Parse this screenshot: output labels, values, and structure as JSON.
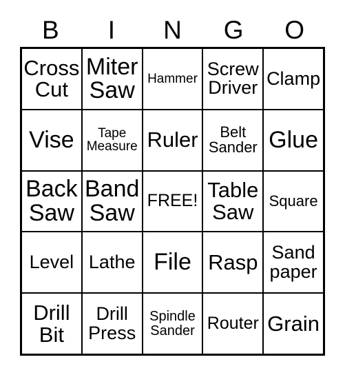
{
  "card": {
    "title": "BINGO",
    "free_space_label": "FREE!",
    "colors": {
      "background": "#ffffff",
      "text": "#000000",
      "border": "#000000"
    },
    "header": {
      "letters": [
        "B",
        "I",
        "N",
        "G",
        "O"
      ]
    },
    "grid": {
      "columns": 5,
      "rows": 5,
      "cells": [
        [
          {
            "label": "Cross\nCut",
            "size": "fs-lg",
            "free": false
          },
          {
            "label": "Miter\nSaw",
            "size": "fs-xl",
            "free": false
          },
          {
            "label": "Hammer",
            "size": "fs-tiny",
            "free": false
          },
          {
            "label": "Screw\nDriver",
            "size": "fs-md",
            "free": false
          },
          {
            "label": "Clamp",
            "size": "fs-md",
            "free": false
          }
        ],
        [
          {
            "label": "Vise",
            "size": "fs-xl",
            "free": false
          },
          {
            "label": "Tape\nMeasure",
            "size": "fs-tiny",
            "free": false
          },
          {
            "label": "Ruler",
            "size": "fs-lg",
            "free": false
          },
          {
            "label": "Belt\nSander",
            "size": "fs-xs",
            "free": false
          },
          {
            "label": "Glue",
            "size": "fs-xl",
            "free": false
          }
        ],
        [
          {
            "label": "Back\nSaw",
            "size": "fs-xl",
            "free": false
          },
          {
            "label": "Band\nSaw",
            "size": "fs-xl",
            "free": false
          },
          {
            "label": "FREE!",
            "size": "fs-sm",
            "free": true
          },
          {
            "label": "Table\nSaw",
            "size": "fs-lg",
            "free": false
          },
          {
            "label": "Square",
            "size": "fs-xs",
            "free": false
          }
        ],
        [
          {
            "label": "Level",
            "size": "fs-md",
            "free": false
          },
          {
            "label": "Lathe",
            "size": "fs-md",
            "free": false
          },
          {
            "label": "File",
            "size": "fs-xl",
            "free": false
          },
          {
            "label": "Rasp",
            "size": "fs-lg",
            "free": false
          },
          {
            "label": "Sand\npaper",
            "size": "fs-md",
            "free": false
          }
        ],
        [
          {
            "label": "Drill\nBit",
            "size": "fs-lg",
            "free": false
          },
          {
            "label": "Drill\nPress",
            "size": "fs-md",
            "free": false
          },
          {
            "label": "Spindle\nSander",
            "size": "fs-xxs",
            "free": false
          },
          {
            "label": "Router",
            "size": "fs-sm",
            "free": false
          },
          {
            "label": "Grain",
            "size": "fs-lg",
            "free": false
          }
        ]
      ]
    }
  }
}
